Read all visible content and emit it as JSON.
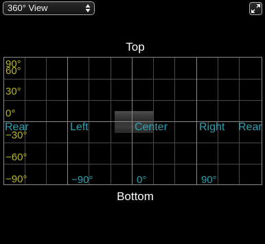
{
  "view_select": {
    "value": "360° View",
    "icon": "select-up-down-arrows-icon"
  },
  "expand_button": {
    "icon": "expand-arrows-icon"
  },
  "panorama": {
    "top_label": "Top",
    "bottom_label": "Bottom",
    "elevation_labels": [
      "90°",
      "60°",
      "30°",
      "0°",
      "−30°",
      "−60°",
      "−90°"
    ],
    "azimuth_labels": [
      "Rear",
      "Left",
      "Center",
      "Right",
      "Rear"
    ],
    "azimuth_degree_labels": [
      "−90°",
      "0°",
      "90°"
    ],
    "colors": {
      "elevation": "#b9b628",
      "azimuth": "#2aa3b4",
      "grid": "#4a4a4a",
      "crosshair": "#8a8a8a"
    }
  }
}
